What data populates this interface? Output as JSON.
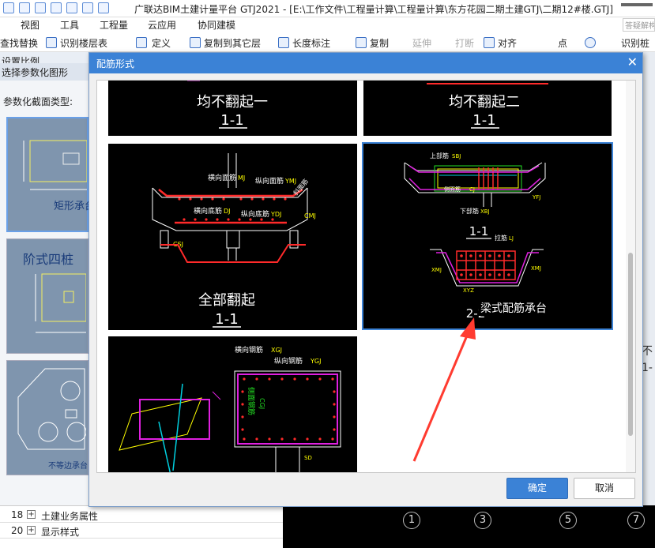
{
  "app": {
    "title": "广联达BIM土建计量平台 GTJ2021 - [E:\\工作文件\\工程量计算\\工程量计算\\东方花园二期土建GTJ\\二期12#楼.GTJ]"
  },
  "menu": {
    "tabs": [
      "视图",
      "工具",
      "工程量",
      "云应用",
      "协同建模"
    ],
    "search_placeholder": "答疑解构"
  },
  "toolbar": {
    "find_replace": "查找替换",
    "identify_floor_table": "识别楼层表",
    "define": "定义",
    "copy_to_other_floor": "复制到其它层",
    "length_dim": "长度标注",
    "copy": "复制",
    "extend": "延伸",
    "break": "打断",
    "align": "对齐",
    "point": "点",
    "identify": "识别桩"
  },
  "left_panel": {
    "row1": "设置比例",
    "row2": "选择参数化图形",
    "type_label": "参数化截面类型:",
    "thumbs": [
      {
        "title": "矩形承台"
      },
      {
        "title": "阶式四桩"
      },
      {
        "title": "不等边承台"
      }
    ]
  },
  "dialog": {
    "title": "配筋形式",
    "ok": "确定",
    "cancel": "取消",
    "tiles": [
      {
        "caption": "均不翻起一",
        "section": "1-1"
      },
      {
        "caption": "均不翻起二",
        "section": "1-1"
      },
      {
        "caption": "全部翻起",
        "section": "1-1",
        "labels": [
          "横向面筋",
          "MJ",
          "纵向面筋",
          "YMJ",
          "横向底筋",
          "DJ",
          "纵向底筋",
          "YDJ",
          "CMJ",
          "侧面筋",
          "CSJ",
          "斜面筋"
        ]
      },
      {
        "caption": "梁式配筋承台",
        "section": "1-1",
        "section2": "2-2",
        "labels": [
          "上部筋",
          "SBJ",
          "侧面筋",
          "CJ",
          "XMJ",
          "下部筋",
          "XBJ",
          "箍筋",
          "GJ",
          "XMJ",
          "YFJ",
          "XYZ",
          "拉筋",
          "LJ",
          "GJ"
        ]
      },
      {
        "caption": "",
        "section": "",
        "labels": [
          "横向钢筋",
          "XGJ",
          "纵向钢筋",
          "YGJ",
          "侧面钢筋",
          "CGJ",
          "SD"
        ]
      }
    ]
  },
  "bottom_list": [
    {
      "num": "18",
      "text": "土建业务属性"
    },
    {
      "num": "20",
      "text": "显示样式"
    }
  ],
  "cad_axes": [
    "1",
    "3",
    "5",
    "7"
  ],
  "right_panel": {
    "text1": "识别桩",
    "text2": "不",
    "text3": "1-"
  },
  "colors": {
    "accent": "#3b82d6",
    "rebar_red": "#ff2a2a",
    "rebar_magenta": "#e020e0",
    "rebar_yellow": "#ffff00",
    "rebar_green": "#23e023",
    "cyan": "#00d0e0",
    "annotation_red": "#ff3b30"
  }
}
